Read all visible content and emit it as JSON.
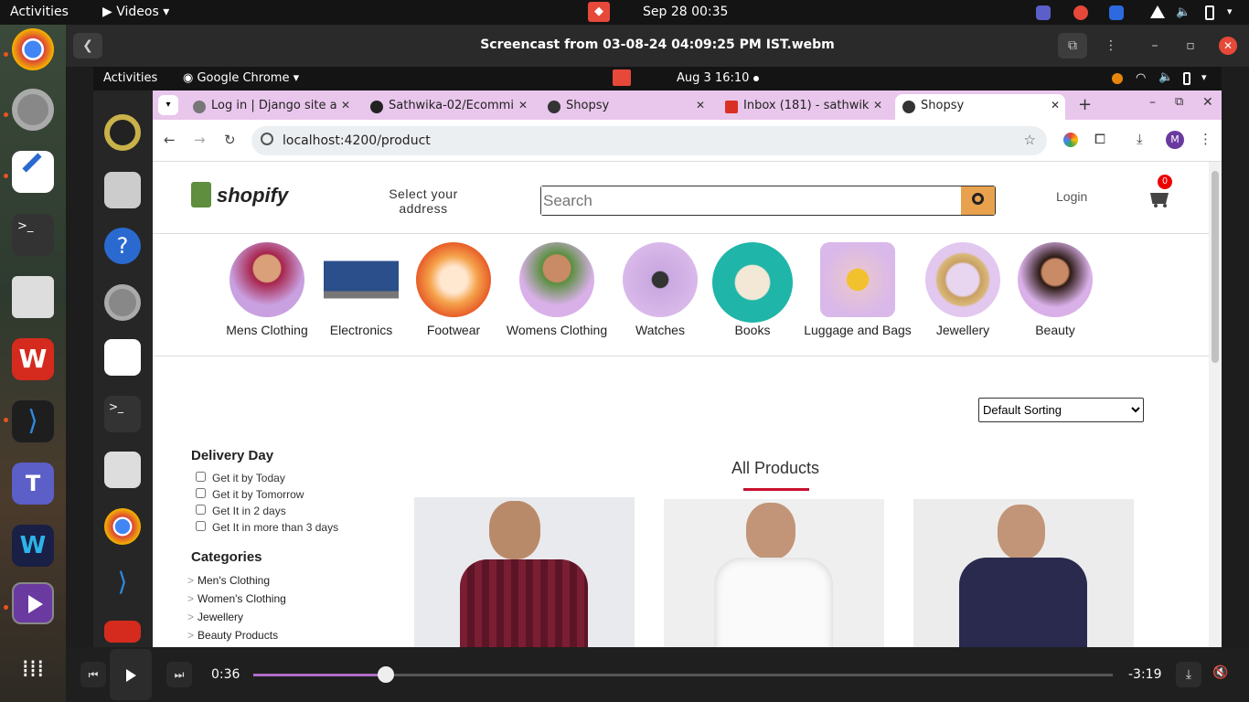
{
  "system_bar": {
    "activities": "Activities",
    "app_menu": "Videos",
    "clock": "Sep 28  00:35"
  },
  "player": {
    "title": "Screencast from 03-08-24 04:09:25 PM IST.webm",
    "elapsed": "0:36",
    "remaining": "-3:19",
    "progress_fraction": 0.154
  },
  "recording": {
    "activities": "Activities",
    "app_menu": "Google Chrome",
    "clock": "Aug 3  16:10"
  },
  "browser": {
    "tabs": [
      {
        "label": "Log in | Django site a",
        "icon": "globe-icon"
      },
      {
        "label": "Sathwika-02/Ecommi",
        "icon": "github-icon"
      },
      {
        "label": "Shopsy",
        "icon": "angular-icon"
      },
      {
        "label": "Inbox (181) - sathwik",
        "icon": "gmail-icon"
      },
      {
        "label": "Shopsy",
        "icon": "angular-icon"
      }
    ],
    "url": "localhost:4200/product",
    "profile_initial": "M"
  },
  "site": {
    "logo": "shopify",
    "address_line1": "Select your",
    "address_line2": "address",
    "search_placeholder": "Search",
    "login": "Login",
    "cart_count": "0",
    "categories": [
      "Mens Clothing",
      "Electronics",
      "Footwear",
      "Womens Clothing",
      "Watches",
      "Books",
      "Luggage and Bags",
      "Jewellery",
      "Beauty"
    ],
    "sorting_value": "Default Sorting",
    "section_title": "All Products",
    "filters": {
      "delivery_title": "Delivery Day",
      "delivery_options": [
        "Get it by Today",
        "Get it by Tomorrow",
        "Get It in 2 days",
        "Get It in more than 3 days"
      ],
      "categories_title": "Categories",
      "category_links": [
        "Men's Clothing",
        "Women's Clothing",
        "Jewellery",
        "Beauty Products"
      ]
    }
  },
  "colors": {
    "accent_orange": "#e8a14d",
    "underline_red": "#c8102e",
    "tab_strip": "#e9c6ec",
    "shopify_green": "#5e8e3e"
  }
}
